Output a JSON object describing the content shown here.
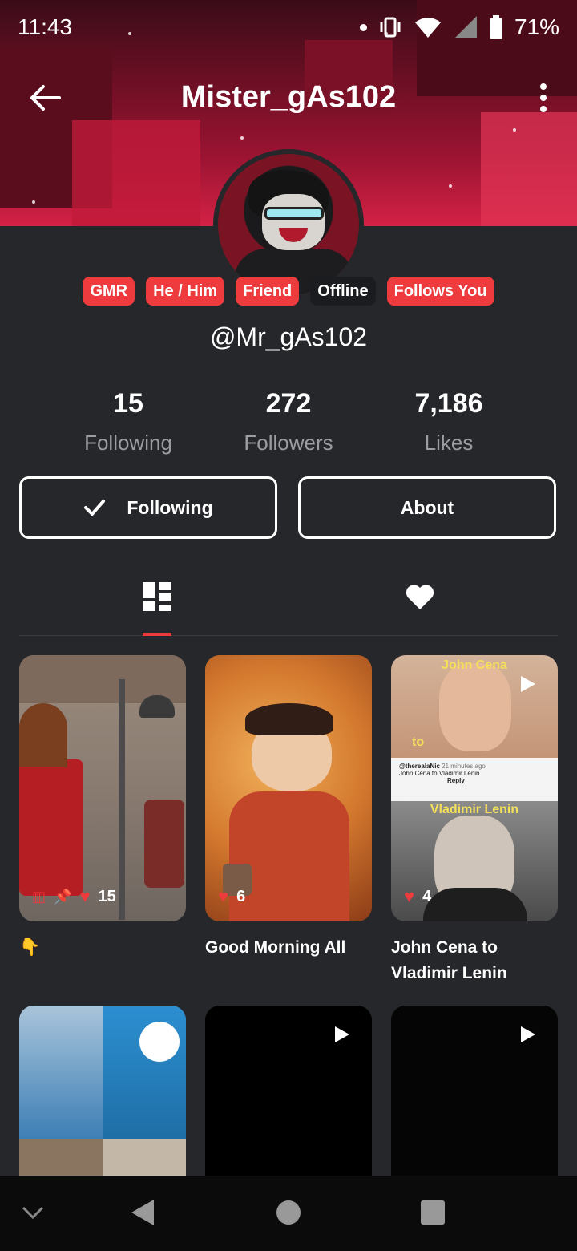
{
  "status_bar": {
    "time": "11:43",
    "battery": "71%"
  },
  "app_bar": {
    "title": "Mister_gAs102"
  },
  "profile": {
    "badges": [
      "GMR",
      "He / Him",
      "Friend",
      "Offline",
      "Follows You"
    ],
    "handle": "@Mr_gAs102",
    "stats": [
      {
        "value": "15",
        "label": "Following"
      },
      {
        "value": "272",
        "label": "Followers"
      },
      {
        "value": "7,186",
        "label": "Likes"
      }
    ]
  },
  "actions": {
    "following_label": "Following",
    "about_label": "About"
  },
  "tabs": [
    {
      "icon": "grid-icon",
      "active": true
    },
    {
      "icon": "heart-icon",
      "active": false
    }
  ],
  "posts": [
    {
      "likes": "15",
      "caption": "👇"
    },
    {
      "likes": "6",
      "caption": "Good Morning All"
    },
    {
      "likes": "4",
      "caption": "John Cena to Vladimir Lenin"
    },
    {
      "likes": "",
      "caption": ""
    },
    {
      "likes": "",
      "caption": ""
    },
    {
      "likes": "",
      "caption": ""
    }
  ],
  "thumb_text": {
    "cena_top": "John Cena",
    "to": "to",
    "lenin_label": "Vladimir Lenin",
    "comment_user": "@therealaNic",
    "comment_time": "21 minutes ago",
    "comment_text": "John Cena to Vladimir Lenin",
    "reply": "Reply"
  },
  "colors": {
    "accent": "#ee3b3d",
    "background": "#26272b"
  }
}
